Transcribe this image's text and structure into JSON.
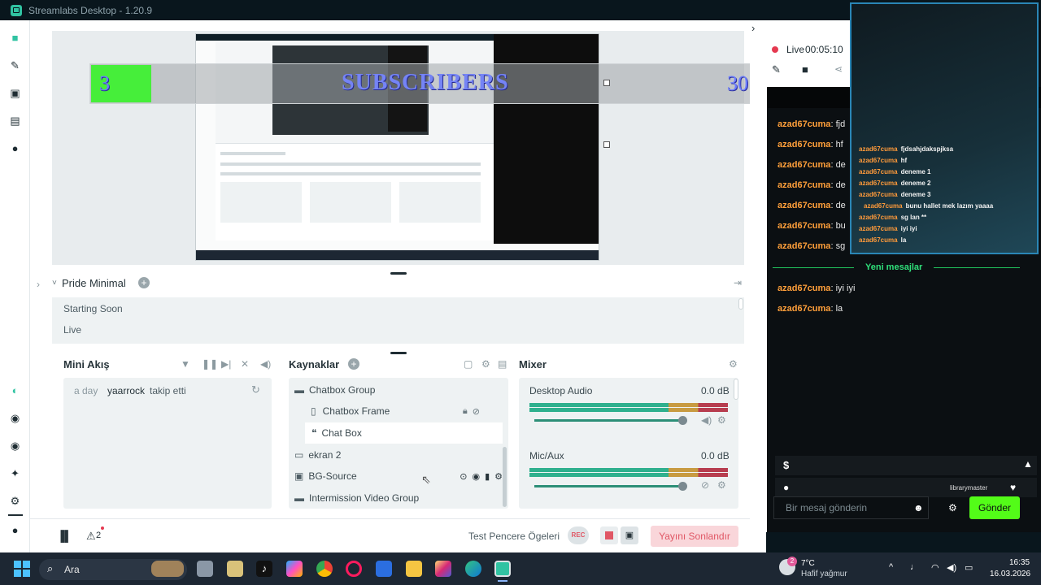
{
  "app": {
    "title": "Streamlabs Desktop - 1.20.9"
  },
  "overlay_widget": {
    "left_count": "3",
    "label": "SUBSCRIBERS",
    "right_count": "30"
  },
  "scenes": {
    "collection": "Pride Minimal",
    "items": [
      "Starting Soon",
      "Live"
    ]
  },
  "mini_feed": {
    "title": "Mini Akış",
    "events": [
      {
        "time": "a day",
        "user": "yaarrock",
        "action": "takip etti"
      }
    ]
  },
  "sources": {
    "title": "Kaynaklar",
    "items": [
      "Chatbox Group",
      "Chatbox Frame",
      "Chat Box",
      "ekran 2",
      "BG-Source",
      "Intermission Video Group"
    ]
  },
  "mixer": {
    "title": "Mixer",
    "channels": [
      {
        "name": "Desktop Audio",
        "level": "0.0 dB",
        "volume": 0.9
      },
      {
        "name": "Mic/Aux",
        "level": "0.0 dB",
        "volume": 0.9
      }
    ]
  },
  "footer": {
    "alerts_count": "2",
    "test_label": "Test Pencere Ögeleri",
    "rec_label": "REC",
    "end_stream": "Yayını Sonlandır"
  },
  "live": {
    "status": "Live",
    "timer": "00:05:10"
  },
  "chat": {
    "messages": [
      {
        "user": "azad67cuma",
        "text": "fjd"
      },
      {
        "user": "azad67cuma",
        "text": "hf"
      },
      {
        "user": "azad67cuma",
        "text": "de"
      },
      {
        "user": "azad67cuma",
        "text": "de"
      },
      {
        "user": "azad67cuma",
        "text": "de"
      },
      {
        "user": "azad67cuma",
        "text": "bu"
      },
      {
        "user": "azad67cuma",
        "text": "sg"
      }
    ],
    "divider": "Yeni mesajlar",
    "new_messages": [
      {
        "user": "azad67cuma",
        "text": "iyi iyi"
      },
      {
        "user": "azad67cuma",
        "text": "la"
      }
    ],
    "viewer_name": "librarymaster",
    "input_placeholder": "Bir mesaj gönderin",
    "send_label": "Gönder"
  },
  "chat_overlay": {
    "lines": [
      {
        "user": "azad67cuma",
        "text": "fjdsahjdakspjksa"
      },
      {
        "user": "azad67cuma",
        "text": "hf"
      },
      {
        "user": "azad67cuma",
        "text": "deneme 1"
      },
      {
        "user": "azad67cuma",
        "text": "deneme 2"
      },
      {
        "user": "azad67cuma",
        "text": "deneme 3"
      },
      {
        "user": "azad67cuma",
        "text": "bunu hallet mek lazım yaaaa"
      },
      {
        "user": "azad67cuma",
        "text": "sg lan **"
      },
      {
        "user": "azad67cuma",
        "text": "iyi iyi"
      },
      {
        "user": "azad67cuma",
        "text": "la"
      }
    ]
  },
  "taskbar": {
    "search": "Ara",
    "weather_temp": "7°C",
    "weather_desc": "Hafif yağmur",
    "weather_badge": "2",
    "time": "16:35",
    "date": "16.03.2026"
  }
}
